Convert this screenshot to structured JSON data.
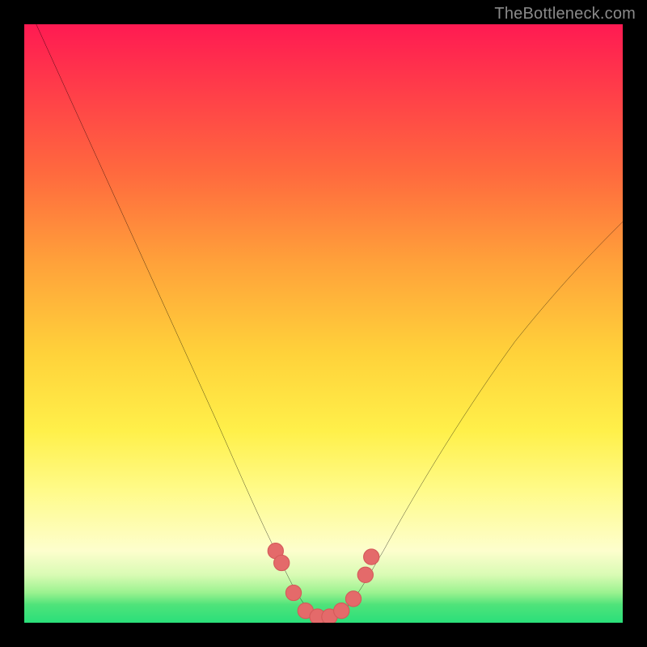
{
  "watermark": {
    "text": "TheBottleneck.com"
  },
  "chart_data": {
    "type": "line",
    "title": "",
    "xlabel": "",
    "ylabel": "",
    "xlim": [
      0,
      100
    ],
    "ylim": [
      0,
      100
    ],
    "grid": false,
    "legend": false,
    "series": [
      {
        "name": "bottleneck-curve",
        "color": "#000000",
        "x": [
          0,
          5,
          10,
          15,
          20,
          25,
          30,
          35,
          40,
          43,
          45,
          47,
          50,
          53,
          55,
          57,
          60,
          65,
          70,
          75,
          80,
          85,
          90,
          95,
          100
        ],
        "y": [
          100,
          90,
          80,
          70,
          60,
          49,
          38,
          27,
          15,
          7,
          3,
          1,
          0,
          1,
          3,
          7,
          12,
          21,
          30,
          38,
          46,
          53,
          59,
          64,
          68
        ]
      }
    ],
    "markers": {
      "name": "dip-points",
      "color": "#e46a6a",
      "x": [
        40,
        41,
        45,
        47,
        50,
        53,
        55,
        57,
        58
      ],
      "y": [
        15,
        12,
        3,
        1,
        0,
        1,
        3,
        7,
        9
      ]
    },
    "background_gradient": {
      "orientation": "vertical",
      "stops": [
        {
          "offset": 0.0,
          "color": "#ff1a52"
        },
        {
          "offset": 0.4,
          "color": "#ffa23a"
        },
        {
          "offset": 0.7,
          "color": "#fff04a"
        },
        {
          "offset": 0.9,
          "color": "#fdfecd"
        },
        {
          "offset": 1.0,
          "color": "#2adf7a"
        }
      ]
    }
  }
}
